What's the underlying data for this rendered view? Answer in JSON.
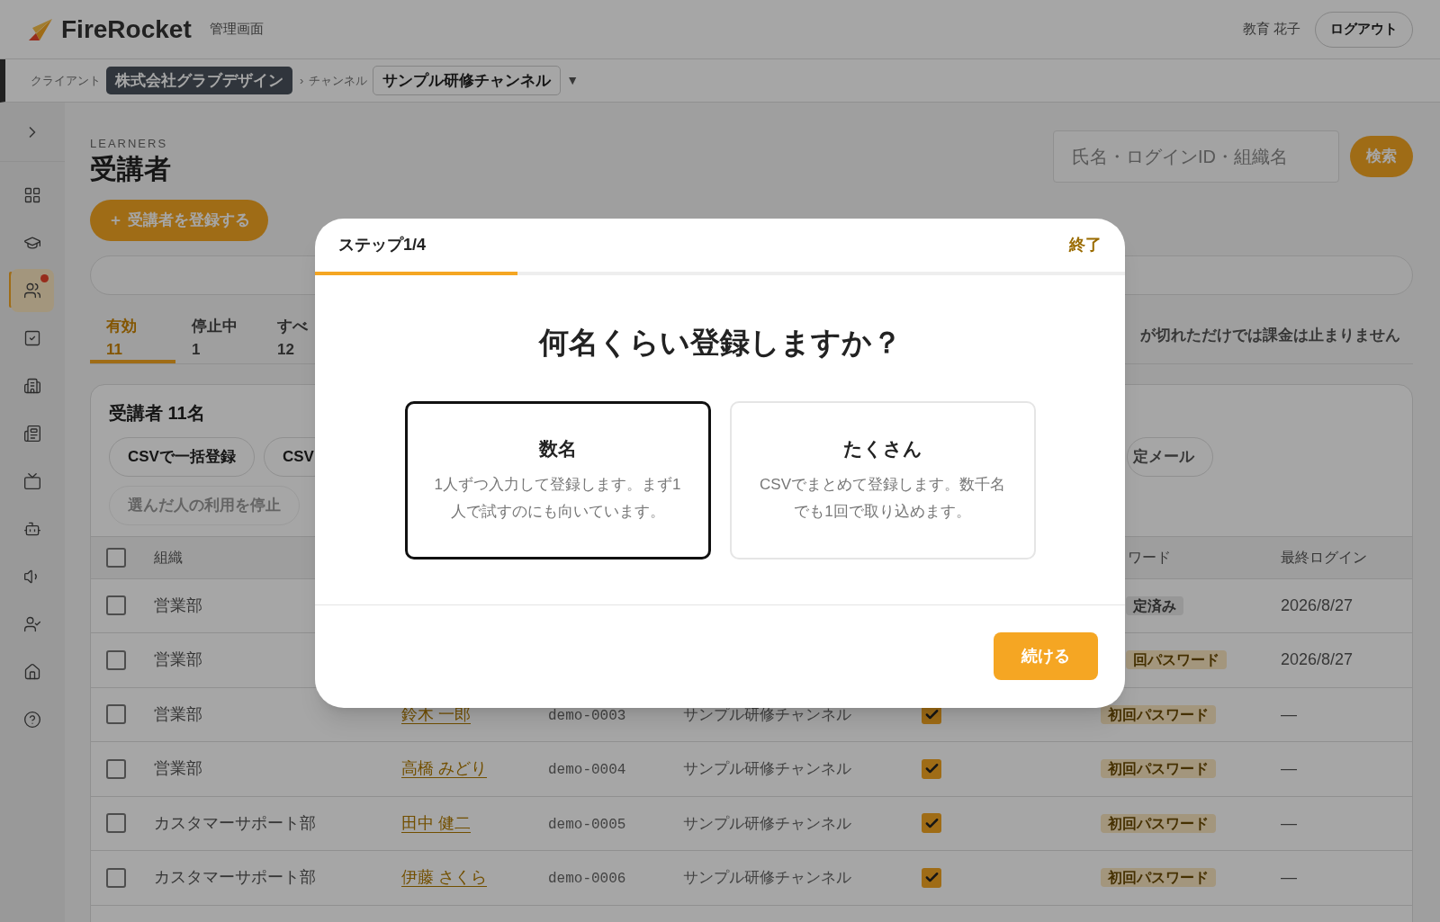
{
  "header": {
    "brand": "FireRocket",
    "subtitle": "管理画面",
    "user": "教育 花子",
    "logout": "ログアウト"
  },
  "breadcrumb": {
    "client_label": "クライアント",
    "client": "株式会社グラブデザイン",
    "separator": "›",
    "channel_label": "チャンネル",
    "channel": "サンプル研修チャンネル",
    "dropdown": "▼"
  },
  "sidebar": {
    "items": [
      {
        "selected": false,
        "notification": false
      },
      {
        "selected": false,
        "notification": false
      },
      {
        "selected": true,
        "notification": true
      },
      {
        "selected": false,
        "notification": false
      },
      {
        "selected": false,
        "notification": false
      },
      {
        "selected": false,
        "notification": false
      },
      {
        "selected": false,
        "notification": false
      },
      {
        "selected": false,
        "notification": false
      },
      {
        "selected": false,
        "notification": false
      },
      {
        "selected": false,
        "notification": false
      },
      {
        "selected": false,
        "notification": false
      },
      {
        "selected": false,
        "notification": false
      }
    ]
  },
  "page": {
    "eyebrow": "LEARNERS",
    "title": "受講者",
    "register_button": "＋ 受講者を登録する",
    "search": {
      "placeholder": "氏名・ログインID・組織名"
    },
    "search_button": "検索"
  },
  "tabs": [
    {
      "label": "有効",
      "count": "11",
      "selected": true
    },
    {
      "label": "停止中",
      "count": "1",
      "selected": false
    },
    {
      "label": "すべ",
      "count": "12",
      "selected": false
    }
  ],
  "note": "が切れただけでは課金は止まりません",
  "card": {
    "title": "受講者 11名",
    "actions": [
      "CSVで一括登録",
      "CSV"
    ],
    "action_right": "定メール",
    "action_disabled": "選んだ人の利用を停止"
  },
  "table": {
    "all_selected": false,
    "columns": {
      "organization": "組織",
      "password": "ワード",
      "last_login": "最終ログイン"
    },
    "rows": [
      {
        "selected": false,
        "organization": "営業部",
        "password": "定済み",
        "kind": "set",
        "last_login": "2026/8/27"
      },
      {
        "selected": false,
        "organization": "営業部",
        "password": "回パスワード",
        "kind": "initial",
        "last_login": "2026/8/27"
      },
      {
        "selected": false,
        "organization": "営業部",
        "name": "鈴木 一郎",
        "login_id": "demo-0003",
        "channel": "サンプル研修チャンネル",
        "enabled": true,
        "password": "初回パスワード",
        "kind": "initial",
        "last_login": "—"
      },
      {
        "selected": false,
        "organization": "営業部",
        "name": "高橋 みどり",
        "login_id": "demo-0004",
        "channel": "サンプル研修チャンネル",
        "enabled": true,
        "password": "初回パスワード",
        "kind": "initial",
        "last_login": "—"
      },
      {
        "selected": false,
        "organization": "カスタマーサポート部",
        "name": "田中 健二",
        "login_id": "demo-0005",
        "channel": "サンプル研修チャンネル",
        "enabled": true,
        "password": "初回パスワード",
        "kind": "initial",
        "last_login": "—"
      },
      {
        "selected": false,
        "organization": "カスタマーサポート部",
        "name": "伊藤 さくら",
        "login_id": "demo-0006",
        "channel": "サンプル研修チャンネル",
        "enabled": true,
        "password": "初回パスワード",
        "kind": "initial",
        "last_login": "—"
      }
    ]
  },
  "dialog": {
    "step": "ステップ1/4",
    "close": "終了",
    "progress": {
      "level": 0.25
    },
    "question": "何名くらい登録しますか？",
    "options": [
      {
        "title": "数名",
        "description": "1人ずつ入力して登録します。まず1人で試すのにも向いています。",
        "selected": true
      },
      {
        "title": "たくさん",
        "description": "CSVでまとめて登録します。数千名でも1回で取り込めます。",
        "selected": false
      }
    ],
    "continue": "続ける"
  }
}
